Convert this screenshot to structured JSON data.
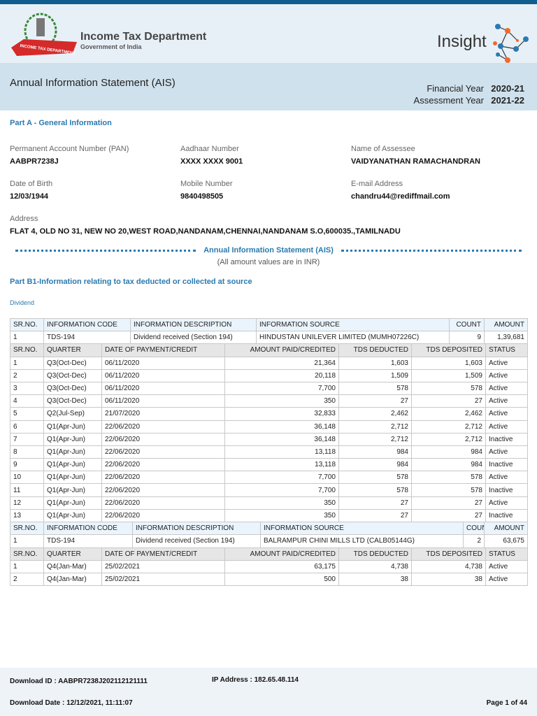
{
  "header": {
    "department": "Income Tax Department",
    "government": "Government of India",
    "emblem_text": "INCOME TAX DEPARTMENT",
    "product": "Insight"
  },
  "title_band": {
    "title": "Annual Information Statement (AIS)",
    "fy_label": "Financial Year",
    "fy_value": "2020-21",
    "ay_label": "Assessment Year",
    "ay_value": "2021-22"
  },
  "part_a": {
    "title": "Part A - General Information",
    "pan_label": "Permanent Account Number (PAN)",
    "pan": "AABPR7238J",
    "aadhaar_label": "Aadhaar Number",
    "aadhaar": "XXXX XXXX 9001",
    "name_label": "Name of Assessee",
    "name": "VAIDYANATHAN RAMACHANDRAN",
    "dob_label": "Date of Birth",
    "dob": "12/03/1944",
    "mobile_label": "Mobile Number",
    "mobile": "9840498505",
    "email_label": "E-mail Address",
    "email": "chandru44@rediffmail.com",
    "address_label": "Address",
    "address": "FLAT 4, OLD NO 31, NEW NO 20,WEST ROAD,NANDANAM,CHENNAI,NANDANAM S.O,600035.,TAMILNADU"
  },
  "divider": {
    "title": "Annual Information Statement (AIS)",
    "subtitle": "(All amount values are in INR)"
  },
  "part_b1": {
    "title": "Part B1-Information relating to tax deducted or collected at source",
    "category": "Dividend"
  },
  "outer_headers": [
    "SR.NO.",
    "INFORMATION CODE",
    "INFORMATION DESCRIPTION",
    "INFORMATION SOURCE",
    "COUNT",
    "AMOUNT"
  ],
  "inner_headers": [
    "SR.NO.",
    "QUARTER",
    "DATE OF PAYMENT/CREDIT",
    "AMOUNT PAID/CREDITED",
    "TDS DEDUCTED",
    "TDS DEPOSITED",
    "STATUS"
  ],
  "groups": [
    {
      "info": [
        "1",
        "TDS-194",
        "Dividend received (Section 194)",
        "HINDUSTAN UNILEVER LIMITED (MUMH07226C)",
        "9",
        "1,39,681"
      ],
      "rows": [
        [
          "1",
          "Q3(Oct-Dec)",
          "06/11/2020",
          "21,364",
          "1,603",
          "1,603",
          "Active"
        ],
        [
          "2",
          "Q3(Oct-Dec)",
          "06/11/2020",
          "20,118",
          "1,509",
          "1,509",
          "Active"
        ],
        [
          "3",
          "Q3(Oct-Dec)",
          "06/11/2020",
          "7,700",
          "578",
          "578",
          "Active"
        ],
        [
          "4",
          "Q3(Oct-Dec)",
          "06/11/2020",
          "350",
          "27",
          "27",
          "Active"
        ],
        [
          "5",
          "Q2(Jul-Sep)",
          "21/07/2020",
          "32,833",
          "2,462",
          "2,462",
          "Active"
        ],
        [
          "6",
          "Q1(Apr-Jun)",
          "22/06/2020",
          "36,148",
          "2,712",
          "2,712",
          "Active"
        ],
        [
          "7",
          "Q1(Apr-Jun)",
          "22/06/2020",
          "36,148",
          "2,712",
          "2,712",
          "Inactive"
        ],
        [
          "8",
          "Q1(Apr-Jun)",
          "22/06/2020",
          "13,118",
          "984",
          "984",
          "Active"
        ],
        [
          "9",
          "Q1(Apr-Jun)",
          "22/06/2020",
          "13,118",
          "984",
          "984",
          "Inactive"
        ],
        [
          "10",
          "Q1(Apr-Jun)",
          "22/06/2020",
          "7,700",
          "578",
          "578",
          "Active"
        ],
        [
          "11",
          "Q1(Apr-Jun)",
          "22/06/2020",
          "7,700",
          "578",
          "578",
          "Inactive"
        ],
        [
          "12",
          "Q1(Apr-Jun)",
          "22/06/2020",
          "350",
          "27",
          "27",
          "Active"
        ],
        [
          "13",
          "Q1(Apr-Jun)",
          "22/06/2020",
          "350",
          "27",
          "27",
          "Inactive"
        ]
      ]
    },
    {
      "info": [
        "1",
        "TDS-194",
        "Dividend received (Section 194)",
        "BALRAMPUR CHINI MILLS LTD (CALB05144G)",
        "2",
        "63,675"
      ],
      "rows": [
        [
          "1",
          "Q4(Jan-Mar)",
          "25/02/2021",
          "63,175",
          "4,738",
          "4,738",
          "Active"
        ],
        [
          "2",
          "Q4(Jan-Mar)",
          "25/02/2021",
          "500",
          "38",
          "38",
          "Active"
        ]
      ]
    }
  ],
  "footer": {
    "download_id": "Download ID : AABPR7238J202112121111",
    "ip": "IP Address : 182.65.48.114",
    "download_date": "Download Date : 12/12/2021, 11:11:07",
    "page": "Page 1 of 44"
  }
}
